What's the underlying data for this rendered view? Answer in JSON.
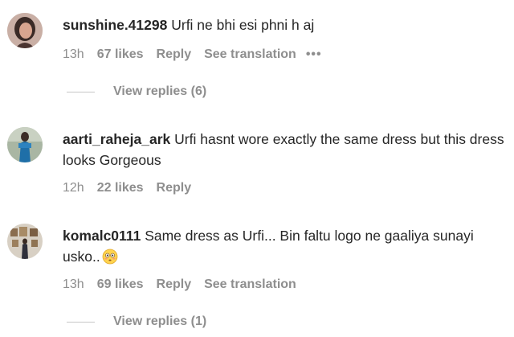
{
  "comments": [
    {
      "username": "sunshine.41298",
      "text": "Urfi ne bhi esi phni h aj",
      "time": "13h",
      "likes": "67 likes",
      "reply": "Reply",
      "translate": "See translation",
      "more": "•••",
      "view_replies": "View replies (6)"
    },
    {
      "username": "aarti_raheja_ark",
      "text": "Urfi hasnt wore exactly the same dress but this dress looks Gorgeous",
      "time": "12h",
      "likes": "22 likes",
      "reply": "Reply"
    },
    {
      "username": "komalc0111",
      "text": "Same dress as Urfi... Bin faltu logo ne gaaliya sunayi usko..",
      "emoji": "flushed-face-emoji",
      "time": "13h",
      "likes": "69 likes",
      "reply": "Reply",
      "translate": "See translation",
      "view_replies": "View replies (1)"
    }
  ],
  "colors": {
    "primary_text": "#262626",
    "secondary_text": "#8e8e8e",
    "divider": "#c7c7c7"
  }
}
